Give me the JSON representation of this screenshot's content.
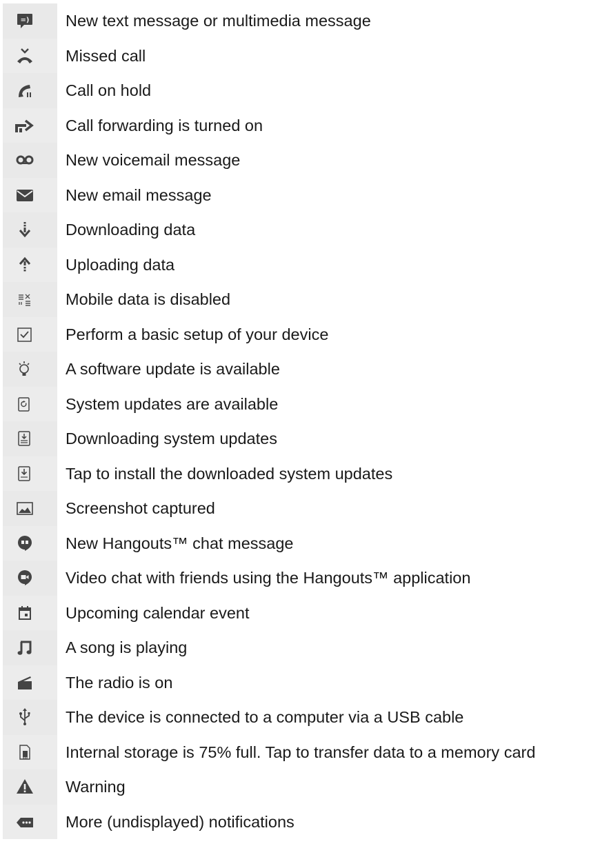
{
  "notifications": [
    {
      "icon": "new-message-icon",
      "label": "New text message or multimedia message"
    },
    {
      "icon": "missed-call-icon",
      "label": "Missed call"
    },
    {
      "icon": "call-on-hold-icon",
      "label": "Call on hold"
    },
    {
      "icon": "call-forwarding-icon",
      "label": "Call forwarding is turned on"
    },
    {
      "icon": "voicemail-icon",
      "label": "New voicemail message"
    },
    {
      "icon": "email-icon",
      "label": "New email message"
    },
    {
      "icon": "download-icon",
      "label": "Downloading data"
    },
    {
      "icon": "upload-icon",
      "label": "Uploading data"
    },
    {
      "icon": "mobile-data-disabled-icon",
      "label": "Mobile data is disabled"
    },
    {
      "icon": "setup-checkbox-icon",
      "label": "Perform a basic setup of your device"
    },
    {
      "icon": "software-update-icon",
      "label": "A software update is available"
    },
    {
      "icon": "system-update-icon",
      "label": "System updates are available"
    },
    {
      "icon": "downloading-system-update-icon",
      "label": "Downloading system updates"
    },
    {
      "icon": "install-update-icon",
      "label": "Tap to install the downloaded system updates"
    },
    {
      "icon": "screenshot-icon",
      "label": "Screenshot captured"
    },
    {
      "icon": "hangouts-chat-icon",
      "label": "New Hangouts™ chat message"
    },
    {
      "icon": "hangouts-video-icon",
      "label": "Video chat with friends using the Hangouts™ application"
    },
    {
      "icon": "calendar-icon",
      "label": "Upcoming calendar event"
    },
    {
      "icon": "music-note-icon",
      "label": "A song is playing"
    },
    {
      "icon": "radio-icon",
      "label": "The radio is on"
    },
    {
      "icon": "usb-icon",
      "label": "The device is connected to a computer via a USB cable"
    },
    {
      "icon": "storage-full-icon",
      "label": "Internal storage is 75% full. Tap to transfer data to a memory card"
    },
    {
      "icon": "warning-icon",
      "label": "Warning"
    },
    {
      "icon": "more-notifications-icon",
      "label": "More (undisplayed) notifications"
    }
  ]
}
